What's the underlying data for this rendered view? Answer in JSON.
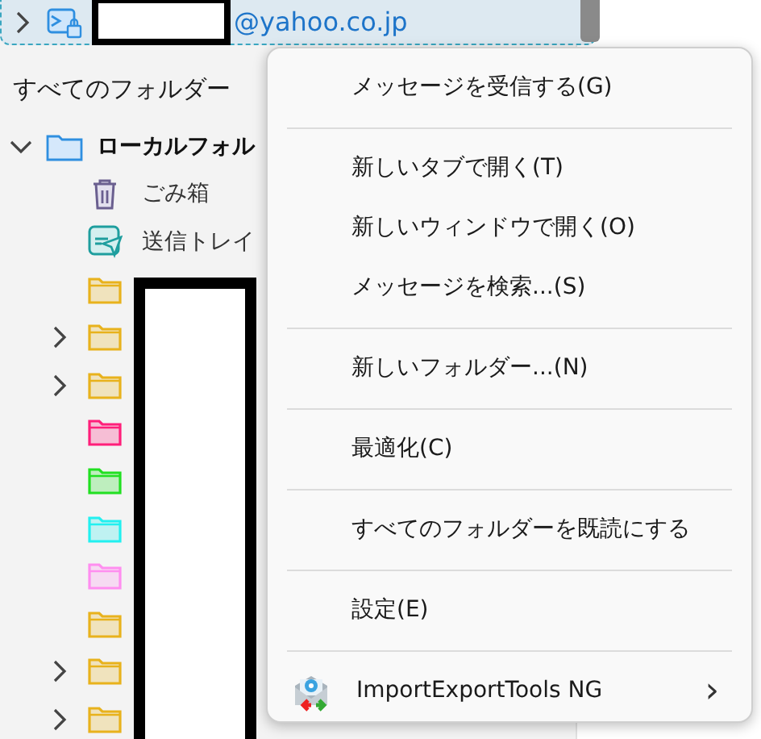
{
  "account": {
    "email_suffix": "@yahoo.co.jp",
    "selected": true
  },
  "folder_pane": {
    "header": "すべてのフォルダー",
    "tree": [
      {
        "kind": "local",
        "label": "ローカルフォル",
        "expanded": true,
        "children": [
          {
            "kind": "trash",
            "label": "ごみ箱",
            "expandable": false
          },
          {
            "kind": "outbox",
            "label": "送信トレイ",
            "expandable": false
          },
          {
            "kind": "folder",
            "color": "#e8b21c",
            "expandable": false
          },
          {
            "kind": "folder",
            "color": "#e8b21c",
            "expandable": true
          },
          {
            "kind": "folder",
            "color": "#e8b21c",
            "expandable": true
          },
          {
            "kind": "folder",
            "color": "#ff1f7a",
            "expandable": false
          },
          {
            "kind": "folder",
            "color": "#21e021",
            "expandable": false
          },
          {
            "kind": "folder",
            "color": "#22f0f0",
            "expandable": false
          },
          {
            "kind": "folder",
            "color": "#ff8ef0",
            "expandable": false
          },
          {
            "kind": "folder",
            "color": "#e8b21c",
            "expandable": false
          },
          {
            "kind": "folder",
            "color": "#e8b21c",
            "expandable": true
          },
          {
            "kind": "folder",
            "color": "#e8b21c",
            "expandable": true
          }
        ]
      }
    ]
  },
  "context_menu": {
    "items": [
      {
        "kind": "item",
        "label": "メッセージを受信する(G)"
      },
      {
        "kind": "separator"
      },
      {
        "kind": "item",
        "label": "新しいタブで開く(T)"
      },
      {
        "kind": "item",
        "label": "新しいウィンドウで開く(O)"
      },
      {
        "kind": "item",
        "label": "メッセージを検索...(S)"
      },
      {
        "kind": "separator"
      },
      {
        "kind": "item",
        "label": "新しいフォルダー...(N)"
      },
      {
        "kind": "separator"
      },
      {
        "kind": "item",
        "label": "最適化(C)"
      },
      {
        "kind": "separator"
      },
      {
        "kind": "item",
        "label": "すべてのフォルダーを既読にする"
      },
      {
        "kind": "separator"
      },
      {
        "kind": "item",
        "label": "設定(E)"
      },
      {
        "kind": "separator"
      },
      {
        "kind": "submenu",
        "label": "ImportExportTools NG",
        "submenu_arrow": "›"
      }
    ]
  }
}
